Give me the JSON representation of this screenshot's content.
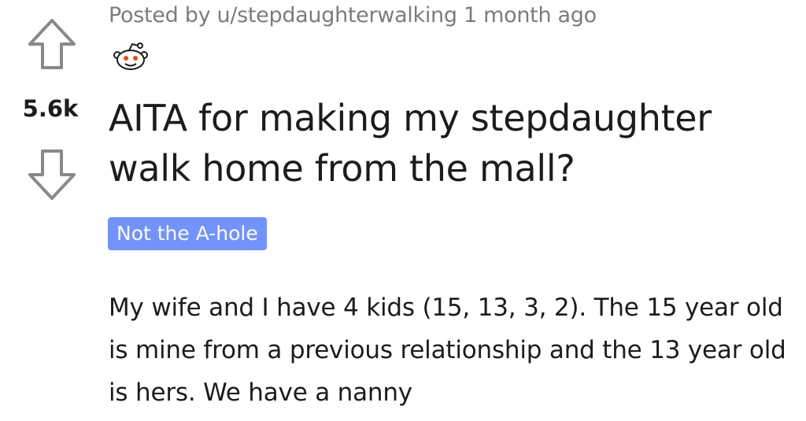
{
  "post": {
    "score": "5.6k",
    "meta": "Posted by u/stepdaughterwalking 1 month ago",
    "title": "AITA for making my stepdaughter walk home from the mall?",
    "flair": "Not the A-hole",
    "body": "My wife and I have 4 kids (15, 13, 3, 2). The 15 year old is mine from a previous relationship and the 13 year old is hers. We have a nanny"
  },
  "icons": {
    "upvote": "upvote-arrow-outline",
    "downvote": "downvote-arrow-outline",
    "avatar": "reddit-snoo-avatar"
  },
  "colors": {
    "text": "#1c1c1c",
    "meta": "#7c7c7c",
    "vote_icon": "#878a8c",
    "flair_bg": "#7193ff",
    "flair_text": "#ffffff"
  }
}
